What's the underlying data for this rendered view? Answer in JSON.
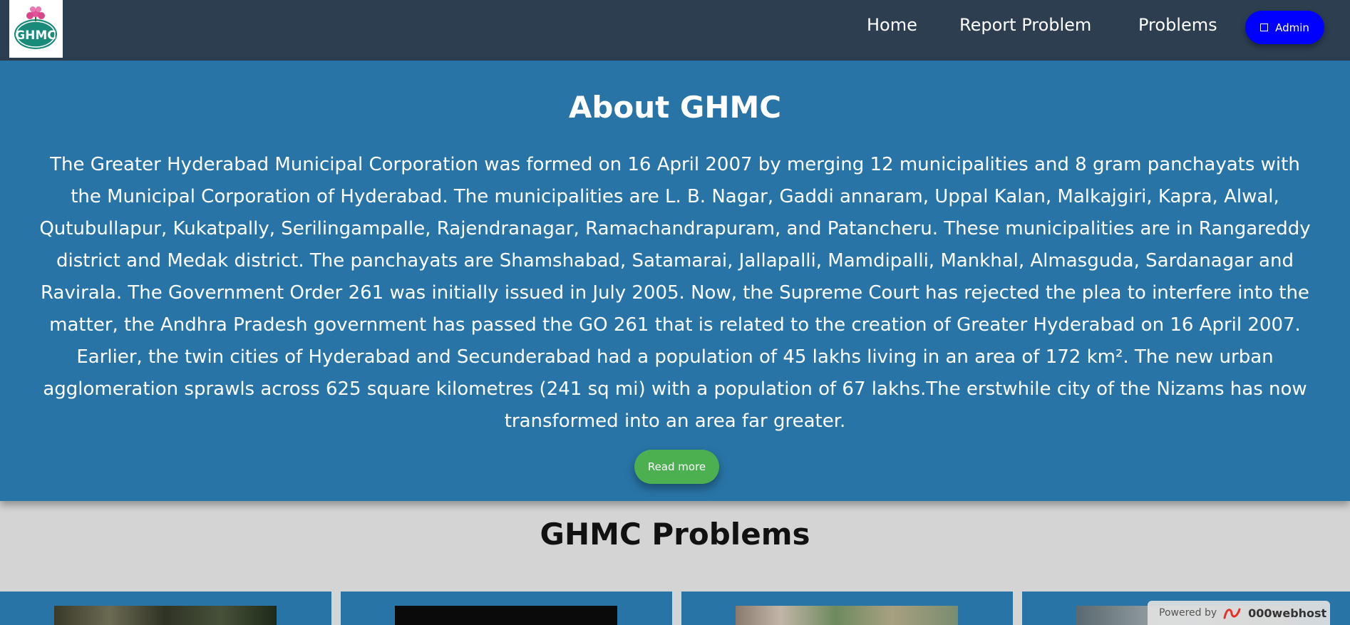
{
  "navbar": {
    "logo_icon": "ghmc-logo",
    "links": [
      {
        "label": "Home"
      },
      {
        "label": "Report Problem"
      },
      {
        "label": "Problems"
      }
    ],
    "admin_label": "Admin",
    "admin_icon": "square-icon",
    "colors": {
      "background": "#2c3e50",
      "admin_button": "#0000ff"
    }
  },
  "about": {
    "title": "About GHMC",
    "text": "The Greater Hyderabad Municipal Corporation was formed on 16 April 2007 by merging 12 municipalities and 8 gram panchayats with the Municipal Corporation of Hyderabad. The municipalities are L. B. Nagar, Gaddi annaram, Uppal Kalan, Malkajgiri, Kapra, Alwal, Qutubullapur, Kukatpally, Serilingampalle, Rajendranagar, Ramachandrapuram, and Patancheru. These municipalities are in Rangareddy district and Medak district. The panchayats are Shamshabad, Satamarai, Jallapalli, Mamdipalli, Mankhal, Almasguda, Sardanagar and Ravirala. The Government Order 261 was initially issued in July 2005. Now, the Supreme Court has rejected the plea to interfere into the matter, the Andhra Pradesh government has passed the GO 261 that is related to the creation of Greater Hyderabad on 16 April 2007. Earlier, the twin cities of Hyderabad and Secunderabad had a population of 45 lakhs living in an area of 172 km². The new urban agglomeration sprawls across 625 square kilometres (241 sq mi) with a population of 67 lakhs.The erstwhile city of the Nizams has now transformed into an area far greater.",
    "read_more_label": "Read more",
    "colors": {
      "background": "#2874a6",
      "button": "#4caf50"
    }
  },
  "problems": {
    "title": "GHMC Problems",
    "cards": [
      {
        "image": "problem-photo-1"
      },
      {
        "image": "problem-photo-2"
      },
      {
        "image": "problem-photo-3"
      },
      {
        "image": "problem-photo-4"
      }
    ]
  },
  "badge": {
    "label": "Powered by",
    "brand": "000webhost"
  }
}
